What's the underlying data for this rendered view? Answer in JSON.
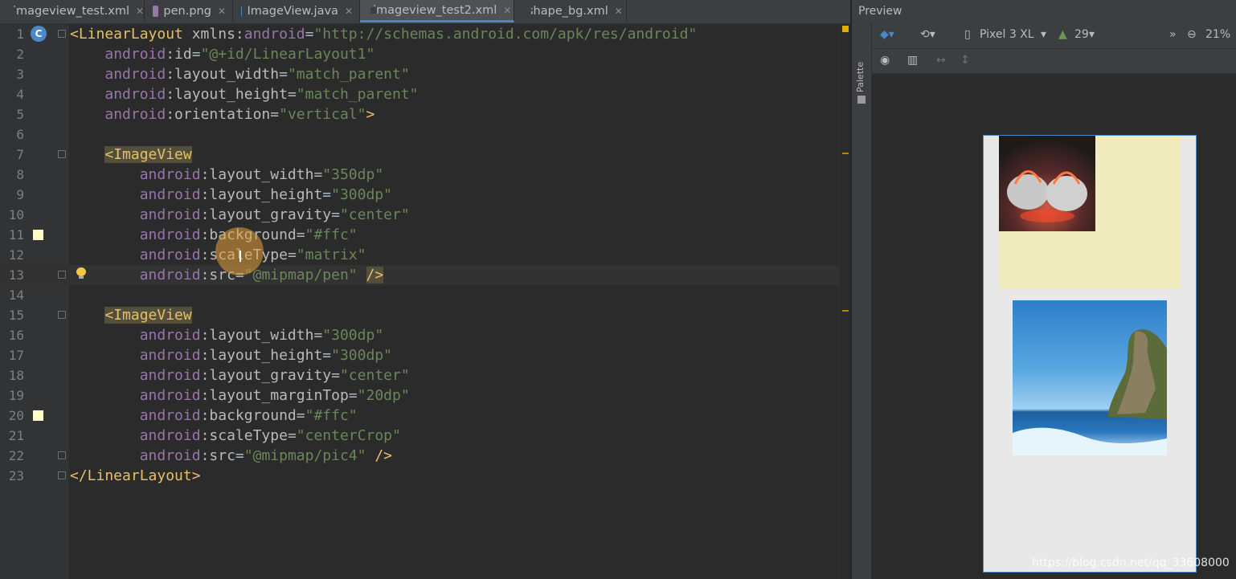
{
  "tabs": [
    {
      "label": "imageview_test.xml",
      "icon": "xml-file-icon",
      "active": false
    },
    {
      "label": "pen.png",
      "icon": "image-file-icon",
      "active": false
    },
    {
      "label": "ImageView.java",
      "icon": "java-class-icon",
      "active": false
    },
    {
      "label": "imageview_test2.xml",
      "icon": "xml-file-icon",
      "active": true
    },
    {
      "label": "shape_bg.xml",
      "icon": "xml-file-icon",
      "active": false
    }
  ],
  "editor": {
    "line_numbers": [
      "1",
      "2",
      "3",
      "4",
      "5",
      "6",
      "7",
      "8",
      "9",
      "10",
      "11",
      "12",
      "13",
      "14",
      "15",
      "16",
      "17",
      "18",
      "19",
      "20",
      "21",
      "22",
      "23"
    ],
    "current_line": "13",
    "color_swatch_value": "#ffc"
  },
  "preview": {
    "title": "Preview",
    "palette_label": "Palette",
    "device": "Pixel 3 XL",
    "api": "29",
    "zoom": "21%"
  },
  "watermark": "https://blog.csdn.net/qq_33608000"
}
